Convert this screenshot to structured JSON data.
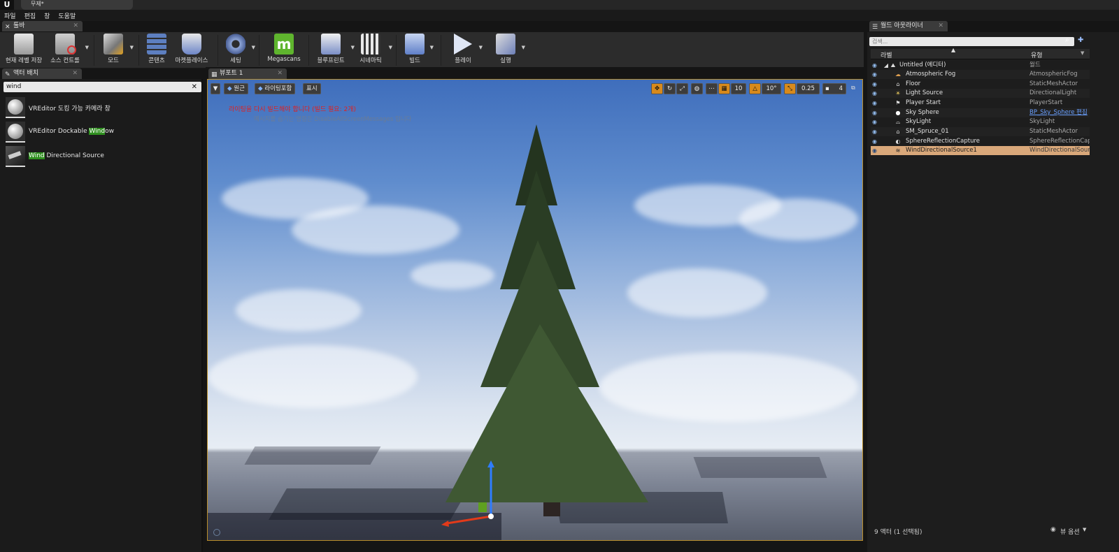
{
  "window": {
    "tab_title": "무제*"
  },
  "menu": [
    "파일",
    "편집",
    "창",
    "도움말"
  ],
  "tabs": {
    "toolbar": "툴바",
    "place_actors": "액터 배치",
    "viewport": "뷰포트 1",
    "outliner": "월드 아웃라이너"
  },
  "toolbar": {
    "buttons": [
      {
        "label": "현재 레벨 저장",
        "icon": "save-icon"
      },
      {
        "label": "소스 컨트롤",
        "icon": "source-control-icon"
      },
      {
        "label": "모드",
        "icon": "modes-icon"
      },
      {
        "label": "콘텐츠",
        "icon": "content-icon"
      },
      {
        "label": "마켓플레이스",
        "icon": "marketplace-icon"
      },
      {
        "label": "세팅",
        "icon": "settings-icon"
      },
      {
        "label": "Megascans",
        "icon": "megascans-icon"
      },
      {
        "label": "블루프린트",
        "icon": "blueprint-icon"
      },
      {
        "label": "시네마틱",
        "icon": "cinematics-icon"
      },
      {
        "label": "빌드",
        "icon": "build-icon"
      },
      {
        "label": "플레이",
        "icon": "play-icon"
      },
      {
        "label": "실행",
        "icon": "launch-icon"
      }
    ]
  },
  "place_actors": {
    "search_value": "wind",
    "items": [
      {
        "pre": "VREditor 도킹 가능 카메라 창",
        "hl": "",
        "post": ""
      },
      {
        "pre": "VREditor Dockable ",
        "hl": "Wind",
        "post": "ow"
      },
      {
        "pre": "",
        "hl": "Wind",
        "post": " Directional Source"
      }
    ]
  },
  "viewport": {
    "perspective": "원근",
    "lit": "라이팅포함",
    "show": "표시",
    "grid_snap": "10",
    "rot_snap": "10°",
    "scale_snap": "0.25",
    "cam_speed": "4",
    "msg_error": "라이팅을 다시 빌드해야 합니다 (빌드 필요: 2개)",
    "msg_hint": "메시지를 숨기는 명령은 DisableAllScreenMessages 입니다"
  },
  "outliner": {
    "search_placeholder": "검색...",
    "col_label": "라벨",
    "col_type": "유형",
    "rows": [
      {
        "name": "Untitled (에디터)",
        "type": "월드",
        "icon": "world-icon"
      },
      {
        "name": "Atmospheric Fog",
        "type": "AtmosphericFog",
        "icon": "fog-icon"
      },
      {
        "name": "Floor",
        "type": "StaticMeshActor",
        "icon": "mesh-icon"
      },
      {
        "name": "Light Source",
        "type": "DirectionalLight",
        "icon": "light-icon"
      },
      {
        "name": "Player Start",
        "type": "PlayerStart",
        "icon": "flag-icon"
      },
      {
        "name": "Sky Sphere",
        "type": "BP_Sky_Sphere 편집",
        "icon": "sphere-icon"
      },
      {
        "name": "SkyLight",
        "type": "SkyLight",
        "icon": "skylight-icon"
      },
      {
        "name": "SM_Spruce_01",
        "type": "StaticMeshActor",
        "icon": "mesh-icon"
      },
      {
        "name": "SphereReflectionCapture",
        "type": "SphereReflectionCapt",
        "icon": "reflection-icon"
      },
      {
        "name": "WindDirectionalSource1",
        "type": "WindDirectionalSourc",
        "icon": "wind-icon"
      }
    ],
    "footer_count": "9 액터 (1 선택됨)",
    "view_options": "뷰 옵션"
  },
  "colors": {
    "accent": "#d88a1c",
    "selection": "#d9a87a",
    "highlight": "#2f8f1f",
    "error": "#e02020"
  }
}
